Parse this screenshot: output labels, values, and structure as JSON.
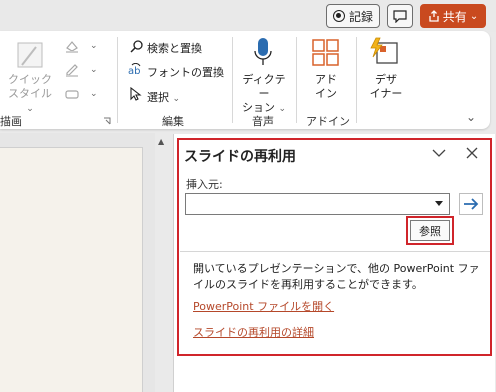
{
  "titlebar": {
    "record_label": "記録",
    "share_label": "共有",
    "share_chevron": "⌄"
  },
  "ribbon": {
    "drawing": {
      "quick_style_line1": "クイック",
      "quick_style_line2": "スタイル",
      "group_label": "図形の描画",
      "group_label_visible": "描画"
    },
    "editing": {
      "find_replace": "検索と置換",
      "font_replace": "フォントの置換",
      "select": "選択",
      "group_label": "編集"
    },
    "voice": {
      "dictate_line1": "ディクテー",
      "dictate_line2": "ション",
      "group_label": "音声"
    },
    "addins": {
      "addins_line1": "アド",
      "addins_line2": "イン",
      "group_label": "アドイン"
    },
    "designer": {
      "designer_line1": "デザ",
      "designer_line2": "イナー"
    }
  },
  "pane": {
    "title": "スライドの再利用",
    "insert_from_label": "挿入元:",
    "source_value": "",
    "browse_button": "参照",
    "description": "開いているプレゼンテーションで、他の PowerPoint ファイルのスライドを再利用することができます。",
    "link_open": "PowerPoint ファイルを開く",
    "link_details": "スライドの再利用の詳細"
  },
  "colors": {
    "highlight_red": "#d0252b",
    "share_orange": "#c94a1f",
    "link_color": "#b5482a",
    "accent_blue": "#2b6cb0"
  }
}
